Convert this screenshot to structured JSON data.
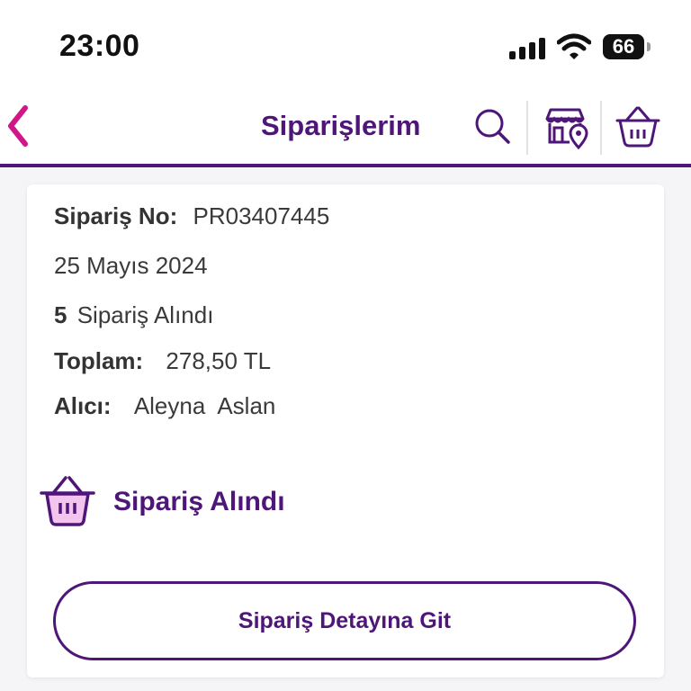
{
  "status_bar": {
    "time": "23:00",
    "battery": "66"
  },
  "nav": {
    "title": "Siparişlerim",
    "icons": [
      "back-chevron-icon",
      "search-icon",
      "store-location-icon",
      "basket-icon"
    ],
    "accent_color": "#4f1679",
    "back_color": "#d1168a"
  },
  "order": {
    "order_no_label": "Sipariş No:",
    "order_no": "PR03407445",
    "date": "25 Mayıs 2024",
    "item_count": "5",
    "item_label": "Sipariş Alındı",
    "total_label": "Toplam:",
    "total": "278,50 TL",
    "recipient_label": "Alıcı:",
    "recipient": "Aleyna  Aslan",
    "status": "Sipariş Alındı",
    "status_icon": "basket-icon",
    "detail_button": "Sipariş Detayına Git"
  }
}
